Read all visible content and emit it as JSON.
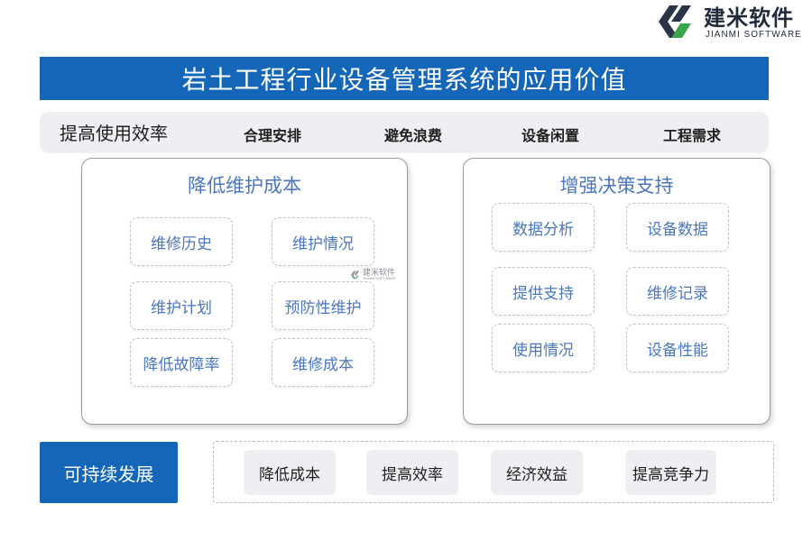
{
  "logo": {
    "name_cn": "建米软件",
    "name_en": "JIANMI SOFTWARE",
    "colors": {
      "dark": "#2a3446",
      "accent": "#3aa34a"
    }
  },
  "title": "岩土工程行业设备管理系统的应用价值",
  "efficiency": {
    "label": "提高使用效率",
    "items": [
      "合理安排",
      "避免浪费",
      "设备闲置",
      "工程需求"
    ]
  },
  "maintenance": {
    "title": "降低维护成本",
    "items": [
      "维修历史",
      "维护情况",
      "维护计划",
      "预防性维护",
      "降低故障率",
      "维修成本"
    ]
  },
  "decision": {
    "title": "增强决策支持",
    "items": [
      "数据分析",
      "设备数据",
      "提供支持",
      "维修记录",
      "使用情况",
      "设备性能"
    ]
  },
  "sustainable": {
    "label": "可持续发展",
    "items": [
      "降低成本",
      "提高效率",
      "经济效益",
      "提高竞争力"
    ]
  },
  "watermark": {
    "name_cn": "建米软件",
    "name_en": "JIANMI SOFTWARE"
  },
  "colors": {
    "primary_blue": "#1466b8",
    "text_blue": "#4a76bf",
    "light_gray": "#eeeff2"
  }
}
